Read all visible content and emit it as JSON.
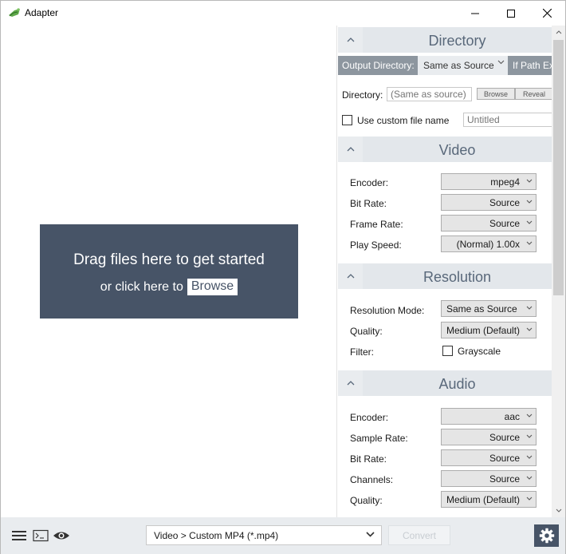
{
  "window": {
    "title": "Adapter"
  },
  "dropzone": {
    "main_text": "Drag files here to get started",
    "sub_text": "or click here to",
    "browse_label": "Browse"
  },
  "directory": {
    "title": "Directory",
    "output_label": "Output Directory:",
    "output_value": "Same as Source",
    "if_path_label": "If Path Exi",
    "dir_label": "Directory:",
    "dir_placeholder": "(Same as source)",
    "browse_label": "Browse",
    "reveal_label": "Reveal",
    "custom_name_label": "Use custom file name",
    "custom_name_placeholder": "Untitled"
  },
  "video": {
    "title": "Video",
    "rows": [
      {
        "label": "Encoder:",
        "value": "mpeg4"
      },
      {
        "label": "Bit Rate:",
        "value": "Source"
      },
      {
        "label": "Frame Rate:",
        "value": "Source"
      },
      {
        "label": "Play Speed:",
        "value": "(Normal) 1.00x"
      }
    ]
  },
  "resolution": {
    "title": "Resolution",
    "mode_label": "Resolution Mode:",
    "mode_value": "Same as Source",
    "quality_label": "Quality:",
    "quality_value": "Medium (Default)",
    "filter_label": "Filter:",
    "grayscale_label": "Grayscale"
  },
  "audio": {
    "title": "Audio",
    "rows": [
      {
        "label": "Encoder:",
        "value": "aac"
      },
      {
        "label": "Sample Rate:",
        "value": "Source"
      },
      {
        "label": "Bit Rate:",
        "value": "Source"
      },
      {
        "label": "Channels:",
        "value": "Source"
      },
      {
        "label": "Quality:",
        "value": "Medium (Default)"
      }
    ]
  },
  "bottom": {
    "preset_value": "Video > Custom MP4 (*.mp4)",
    "convert_label": "Convert"
  },
  "colors": {
    "dropzone_bg": "#475467",
    "section_header_bg": "#e3e7eb",
    "section_title": "#59687a",
    "bottom_bar_bg": "#e9ecef"
  }
}
